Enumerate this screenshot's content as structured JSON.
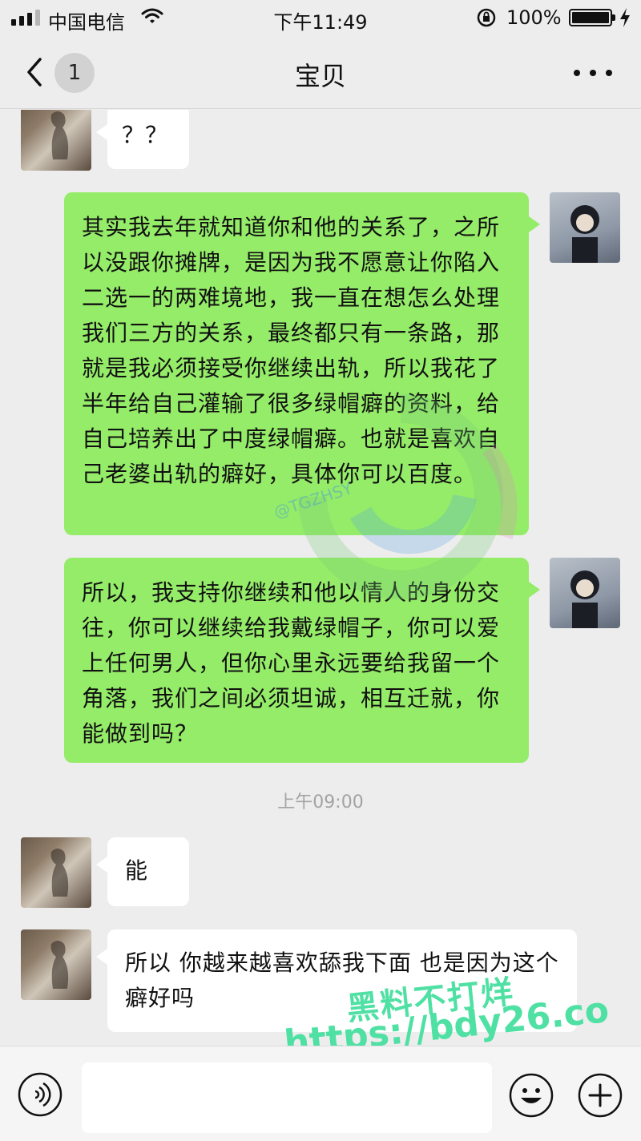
{
  "status_bar": {
    "carrier": "中国电信",
    "time": "下午11:49",
    "battery": "100%",
    "icons": [
      "signal-icon",
      "wifi-icon",
      "orientation-lock-icon",
      "battery-icon",
      "charging-icon"
    ]
  },
  "nav": {
    "back_icon": "chevron-left-icon",
    "unread_count": "1",
    "title": "宝贝",
    "more_icon": "more-dots-icon"
  },
  "messages": [
    {
      "from": "her",
      "text": "？？"
    },
    {
      "from": "me",
      "text": "其实我去年就知道你和他的关系了，之所以没跟你摊牌，是因为我不愿意让你陷入二选一的两难境地，我一直在想怎么处理我们三方的关系，最终都只有一条路，那就是我必须接受你继续出轨，所以我花了半年给自己灌输了很多绿帽癖的资料，给自己培养出了中度绿帽癖。也就是喜欢自己老婆出轨的癖好，具体你可以百度。"
    },
    {
      "from": "me",
      "text": "所以，我支持你继续和他以情人的身份交往，你可以继续给我戴绿帽子，你可以爱上任何男人，但你心里永远要给我留一个角落，我们之间必须坦诚，相互迁就，你能做到吗？"
    },
    {
      "from": "system",
      "text": "上午09:00"
    },
    {
      "from": "her",
      "text": "能"
    },
    {
      "from": "her",
      "text": "所以 你越来越喜欢舔我下面 也是因为这个癖好吗"
    }
  ],
  "watermarks": {
    "handle": "@TGZHSY",
    "site_name": "黑料不打烊",
    "url": "https://bdy26.co"
  },
  "input_bar": {
    "voice_icon": "voice-icon",
    "value": "",
    "emoji_icon": "emoji-icon",
    "plus_icon": "plus-icon"
  },
  "colors": {
    "background": "#ededed",
    "bubble_out": "#95ec69",
    "bubble_in": "#ffffff",
    "watermark_green": "#4fe0a3"
  }
}
